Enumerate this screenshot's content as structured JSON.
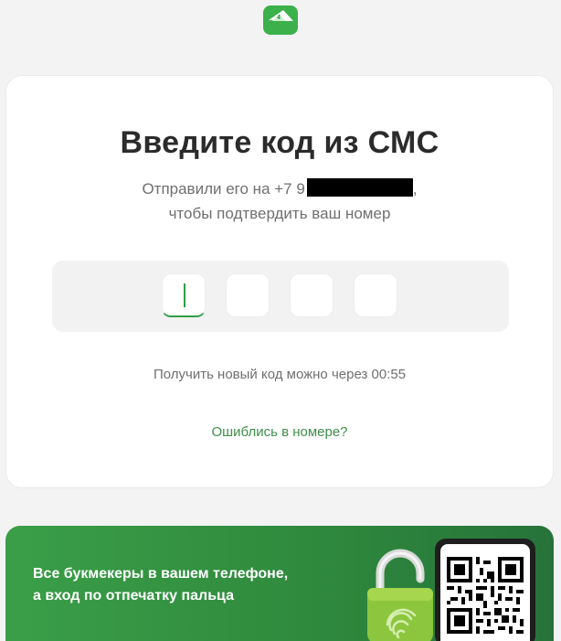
{
  "header": {
    "logo_icon": "bookmaker-app-logo-icon"
  },
  "verification": {
    "title": "Введите код из СМС",
    "sent_prefix": "Отправили его на +7 9",
    "sent_suffix": ",",
    "confirm_line": "чтобы подтвердить ваш номер",
    "code_digits": [
      "",
      "",
      "",
      ""
    ],
    "timer_text": "Получить новый код можно через 00:55",
    "wrong_number_link": "Ошиблись в номере?"
  },
  "promo": {
    "line1": "Все букмекеры в вашем телефоне,",
    "line2": "а вход по отпечатку пальца",
    "lock_icon": "fingerprint-padlock-icon",
    "qr_icon": "qr-code-icon"
  },
  "colors": {
    "accent": "#3cb04a",
    "link": "#3e8f4a",
    "banner": "#2f8a3d"
  }
}
